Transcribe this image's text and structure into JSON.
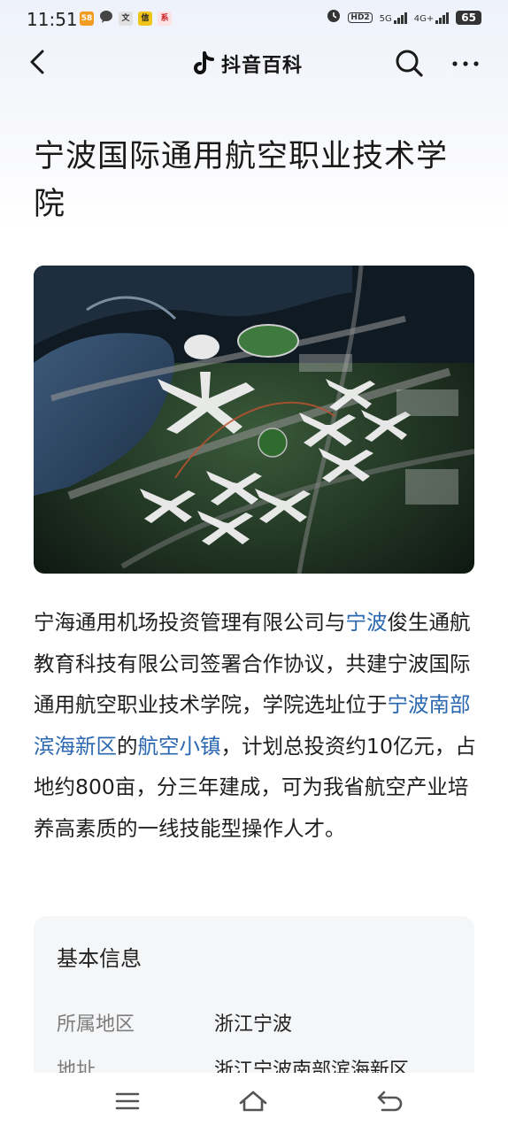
{
  "status_bar": {
    "time": "11:51",
    "app_badges": [
      "58",
      "文",
      "信",
      "系"
    ],
    "hd": "HD2",
    "net1": "5G",
    "net2": "4G+",
    "battery": "65"
  },
  "nav": {
    "brand": "抖音百科",
    "icons": [
      "back-icon",
      "douyin-logo-icon",
      "search-icon",
      "more-icon"
    ]
  },
  "title": "宁波国际通用航空职业技术学院",
  "hero_image": {
    "description_icon": "campus-aerial-render"
  },
  "summary": {
    "p1": "宁海通用机场投资管理有限公司与",
    "link1": "宁波",
    "p2": "俊生通航教育科技有限公司签署合作协议，共建宁波国际通用航空职业技术学院，学院选址位于",
    "link2": "宁波南部滨海新区",
    "p3": "的",
    "link3": "航空小镇",
    "p4": "，计划总投资约10亿元，占地约800亩，分三年建成，可为我省航空产业培养高素质的一线技能型操作人才。"
  },
  "info": {
    "heading": "基本信息",
    "rows": [
      {
        "key": "所属地区",
        "value": "浙江宁波"
      },
      {
        "key": "地址",
        "value": "浙江宁波南部滨海新区"
      }
    ]
  },
  "colors": {
    "link": "#2a67b0",
    "card_bg": "#f5f6f8"
  },
  "bottom_nav": {
    "icons": [
      "menu-icon",
      "home-icon",
      "back-nav-icon"
    ]
  }
}
